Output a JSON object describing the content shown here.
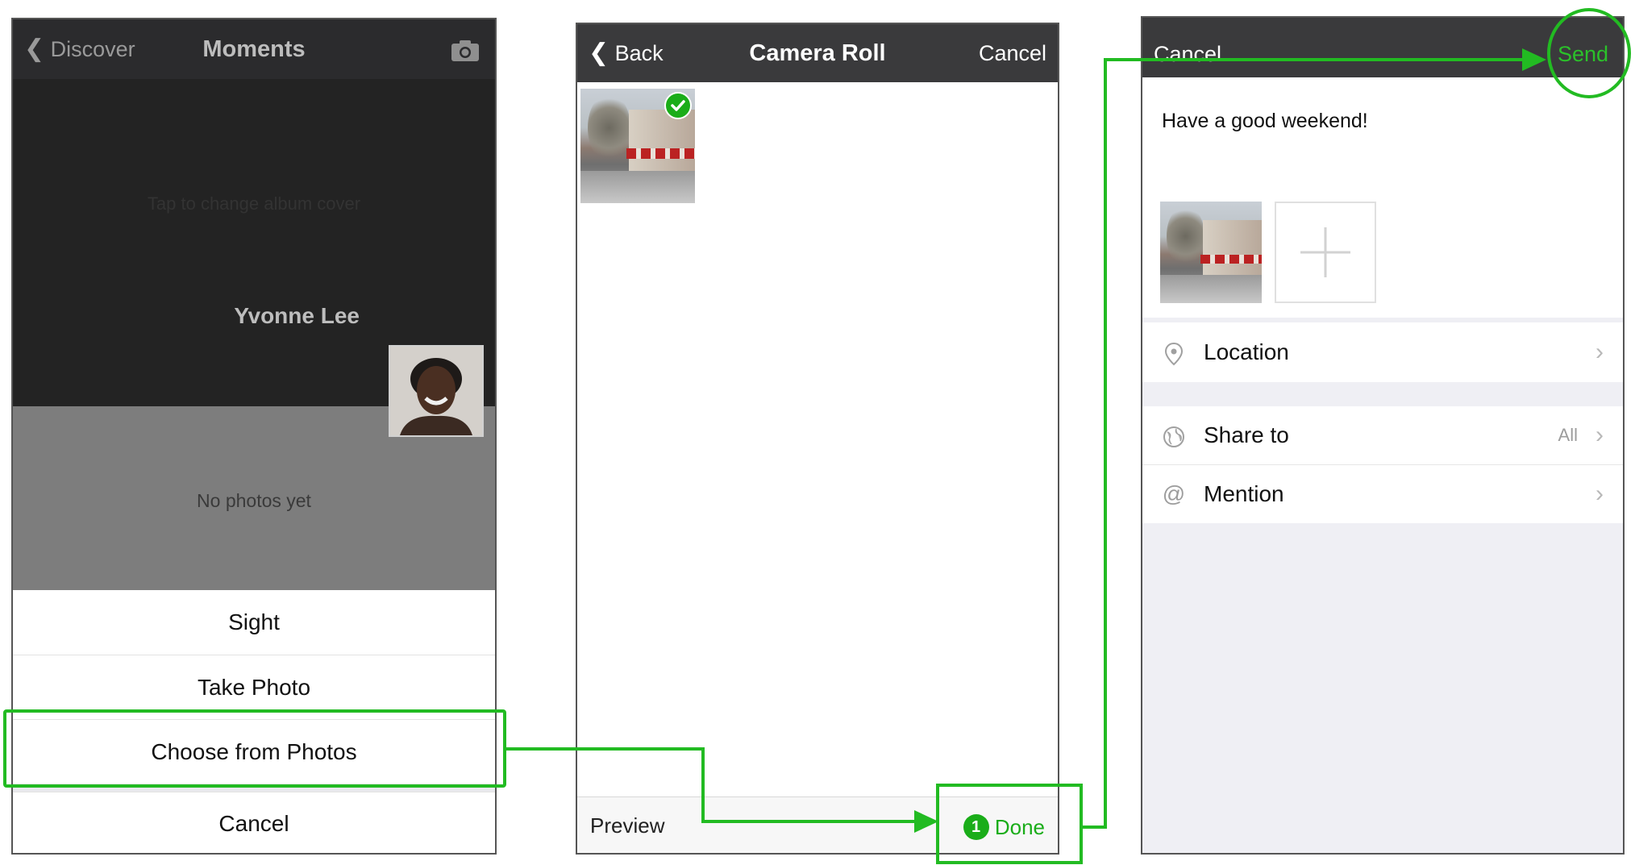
{
  "screen1": {
    "back_label": "Discover",
    "title": "Moments",
    "camera_icon": "camera-icon",
    "cover_hint": "Tap to change album cover",
    "user_name": "Yvonne Lee",
    "no_photos": "No photos yet",
    "sheet_items": [
      "Sight",
      "Take Photo",
      "Choose from Photos",
      "Cancel"
    ]
  },
  "screen2": {
    "back_label": "Back",
    "title": "Camera Roll",
    "cancel_label": "Cancel",
    "preview_label": "Preview",
    "done_count": "1",
    "done_label": "Done"
  },
  "screen3": {
    "cancel_label": "Cancel",
    "send_label": "Send",
    "post_text": "Have a good weekend!",
    "add_photo_icon": "plus-icon",
    "rows": {
      "location": {
        "label": "Location",
        "icon": "location-pin-icon"
      },
      "share_to": {
        "label": "Share to",
        "value": "All",
        "icon": "globe-icon"
      },
      "mention": {
        "label": "Mention",
        "icon": "at-icon"
      }
    }
  },
  "colors": {
    "highlight": "#22bb22",
    "accent_green": "#1aad19",
    "navbar": "#3a3a3c"
  }
}
